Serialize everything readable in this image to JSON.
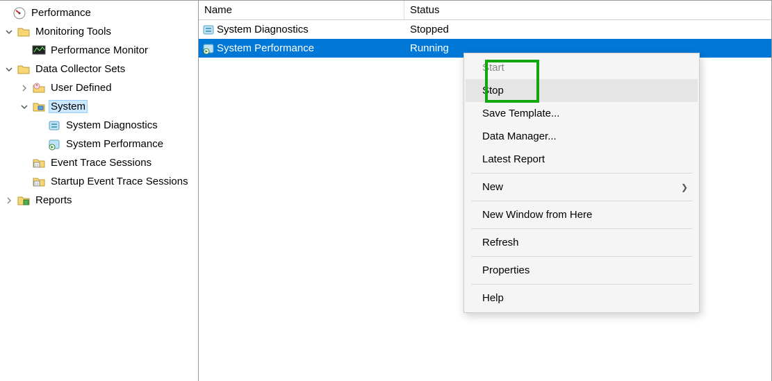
{
  "tree": {
    "root": "Performance",
    "monitoring_tools": "Monitoring Tools",
    "perf_monitor": "Performance Monitor",
    "data_collector_sets": "Data Collector Sets",
    "user_defined": "User Defined",
    "system": "System",
    "sys_diag": "System Diagnostics",
    "sys_perf": "System Performance",
    "event_trace": "Event Trace Sessions",
    "startup_event_trace": "Startup Event Trace Sessions",
    "reports": "Reports"
  },
  "list": {
    "header_name": "Name",
    "header_status": "Status",
    "rows": [
      {
        "name": "System Diagnostics",
        "status": "Stopped"
      },
      {
        "name": "System Performance",
        "status": "Running"
      }
    ]
  },
  "menu": {
    "start": "Start",
    "stop": "Stop",
    "save_template": "Save Template...",
    "data_manager": "Data Manager...",
    "latest_report": "Latest Report",
    "new": "New",
    "new_window": "New Window from Here",
    "refresh": "Refresh",
    "properties": "Properties",
    "help": "Help"
  }
}
